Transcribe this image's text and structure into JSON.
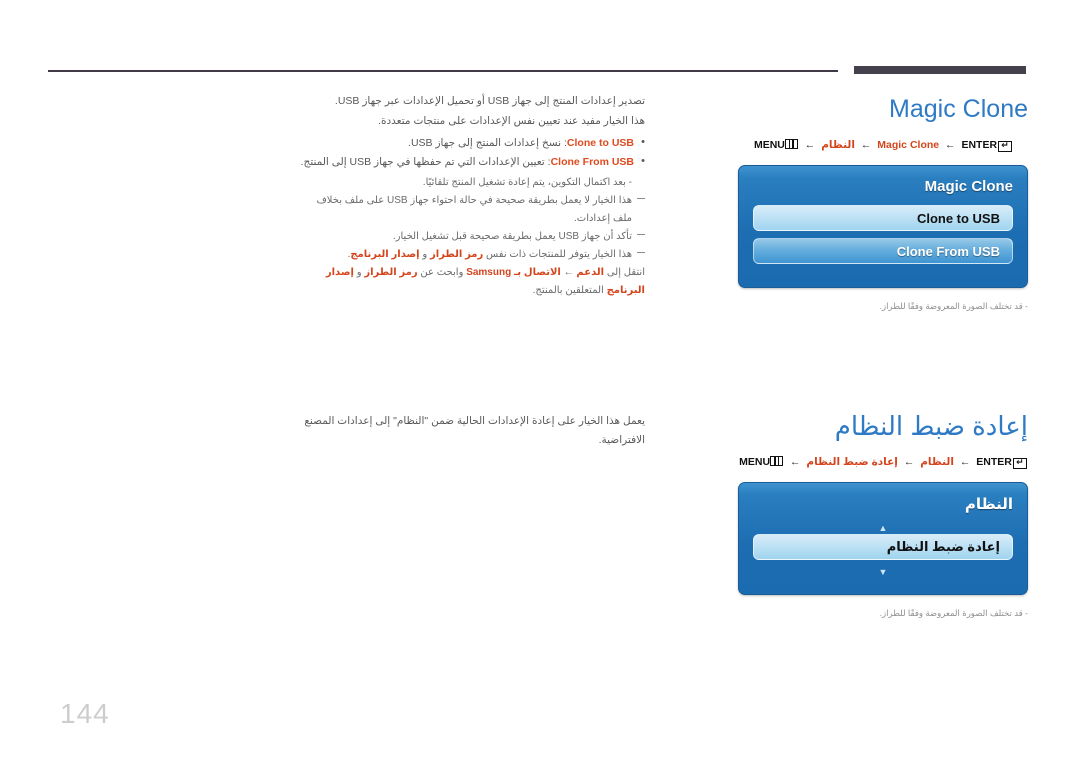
{
  "page": {
    "number": "144"
  },
  "sections": [
    {
      "id": "magic-clone",
      "heading": "Magic Clone",
      "heading_is_latin": true,
      "menu_path": {
        "menu_label": "MENU",
        "arrow": "←",
        "step1": "النظام",
        "step2": "Magic Clone",
        "enter_label": "ENTER",
        "enter_glyph": "↵"
      },
      "osd": {
        "title": "Magic Clone",
        "title_is_latin": true,
        "rows": [
          {
            "label": "Clone to USB",
            "state": "selected",
            "latin": true
          },
          {
            "label": "Clone From USB",
            "state": "normal",
            "latin": true
          }
        ],
        "has_arrows": false
      },
      "caption": "- قد تختلف الصورة المعروضة وفقًا للطراز.",
      "body": {
        "intro1": "تصدير إعدادات المنتج إلى جهاز USB أو تحميل الإعدادات عبر جهاز USB.",
        "intro2": "هذا الخيار مفيد عند تعيين نفس الإعدادات على منتجات متعددة.",
        "bullet1_kw": "Clone to USB",
        "bullet1_text": ": نسخ إعدادات المنتج إلى جهاز USB.",
        "bullet2_kw": "Clone From USB",
        "bullet2_text": ": تعيين الإعدادات التي تم حفظها في جهاز USB إلى المنتج.",
        "sub_note": "- بعد اكتمال التكوين، يتم إعادة تشغيل المنتج تلقائيًا.",
        "note1": "هذا الخيار لا يعمل بطريقة صحيحة في حالة احتواء جهاز USB على ملف بخلاف ملف إعدادات.",
        "note2": "تأكد أن جهاز USB يعمل بطريقة صحيحة قبل تشغيل الخيار.",
        "note3_pre": "هذا الخيار يتوفر للمنتجات ذات نفس ",
        "note3_kw1": "رمز الطراز",
        "note3_mid": " و ",
        "note3_kw2": "إصدار البرنامج",
        "note3_post": ".",
        "note4_pre": "انتقل إلى ",
        "note4_kw1": "الدعم",
        "note4_arrow": " ← ",
        "note4_kw2": "الاتصال بـ Samsung",
        "note4_mid": " وابحث عن ",
        "note4_kw3": "رمز الطراز",
        "note4_mid2": " و ",
        "note4_kw4": "إصدار البرنامج",
        "note4_post": " المتعلقين بالمنتج."
      }
    },
    {
      "id": "system-reset",
      "heading": "إعادة ضبط النظام",
      "heading_is_latin": false,
      "menu_path": {
        "menu_label": "MENU",
        "arrow": "←",
        "step1": "النظام",
        "step2": "إعادة ضبط النظام",
        "enter_label": "ENTER",
        "enter_glyph": "↵"
      },
      "osd": {
        "title": "النظام",
        "title_is_latin": false,
        "rows": [
          {
            "label": "إعادة ضبط النظام",
            "state": "selected",
            "latin": false
          }
        ],
        "has_arrows": true,
        "arrow_up": "▲",
        "arrow_down": "▼"
      },
      "caption": "- قد تختلف الصورة المعروضة وفقًا للطراز.",
      "body": {
        "intro1": "يعمل هذا الخيار على إعادة الإعدادات الحالية ضمن \"النظام\" إلى إعدادات المصنع الافتراضية."
      }
    }
  ]
}
